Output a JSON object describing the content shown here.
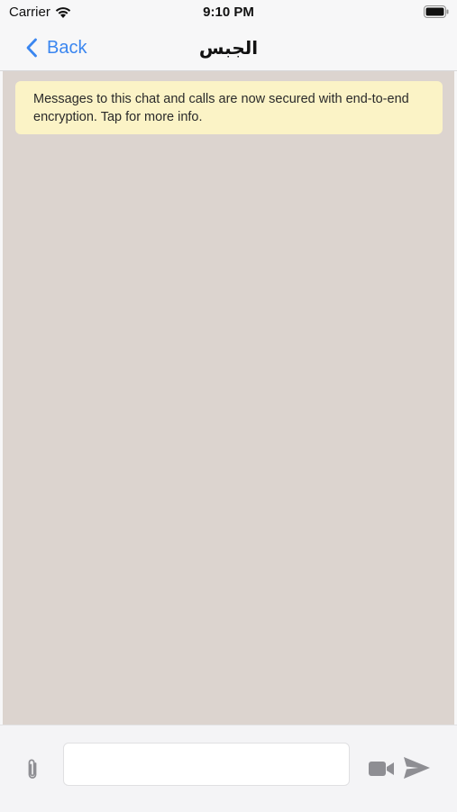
{
  "status_bar": {
    "carrier": "Carrier",
    "time": "9:10 PM",
    "icons": [
      "wifi-icon",
      "battery-icon"
    ]
  },
  "nav": {
    "back_label": "Back",
    "title": "الجبس",
    "icons": [
      "chevron-left-icon"
    ]
  },
  "chat": {
    "encryption_notice": "Messages to this chat and calls are now secured with end-to-end encryption. Tap for more info."
  },
  "composer": {
    "input_value": "",
    "icons": [
      "paperclip-icon",
      "video-camera-icon",
      "send-icon"
    ]
  },
  "colors": {
    "accent": "#3a86f0",
    "chat_background": "#dcd4cf",
    "banner_background": "#fbf3c6",
    "icon_gray": "#8e8e93"
  }
}
